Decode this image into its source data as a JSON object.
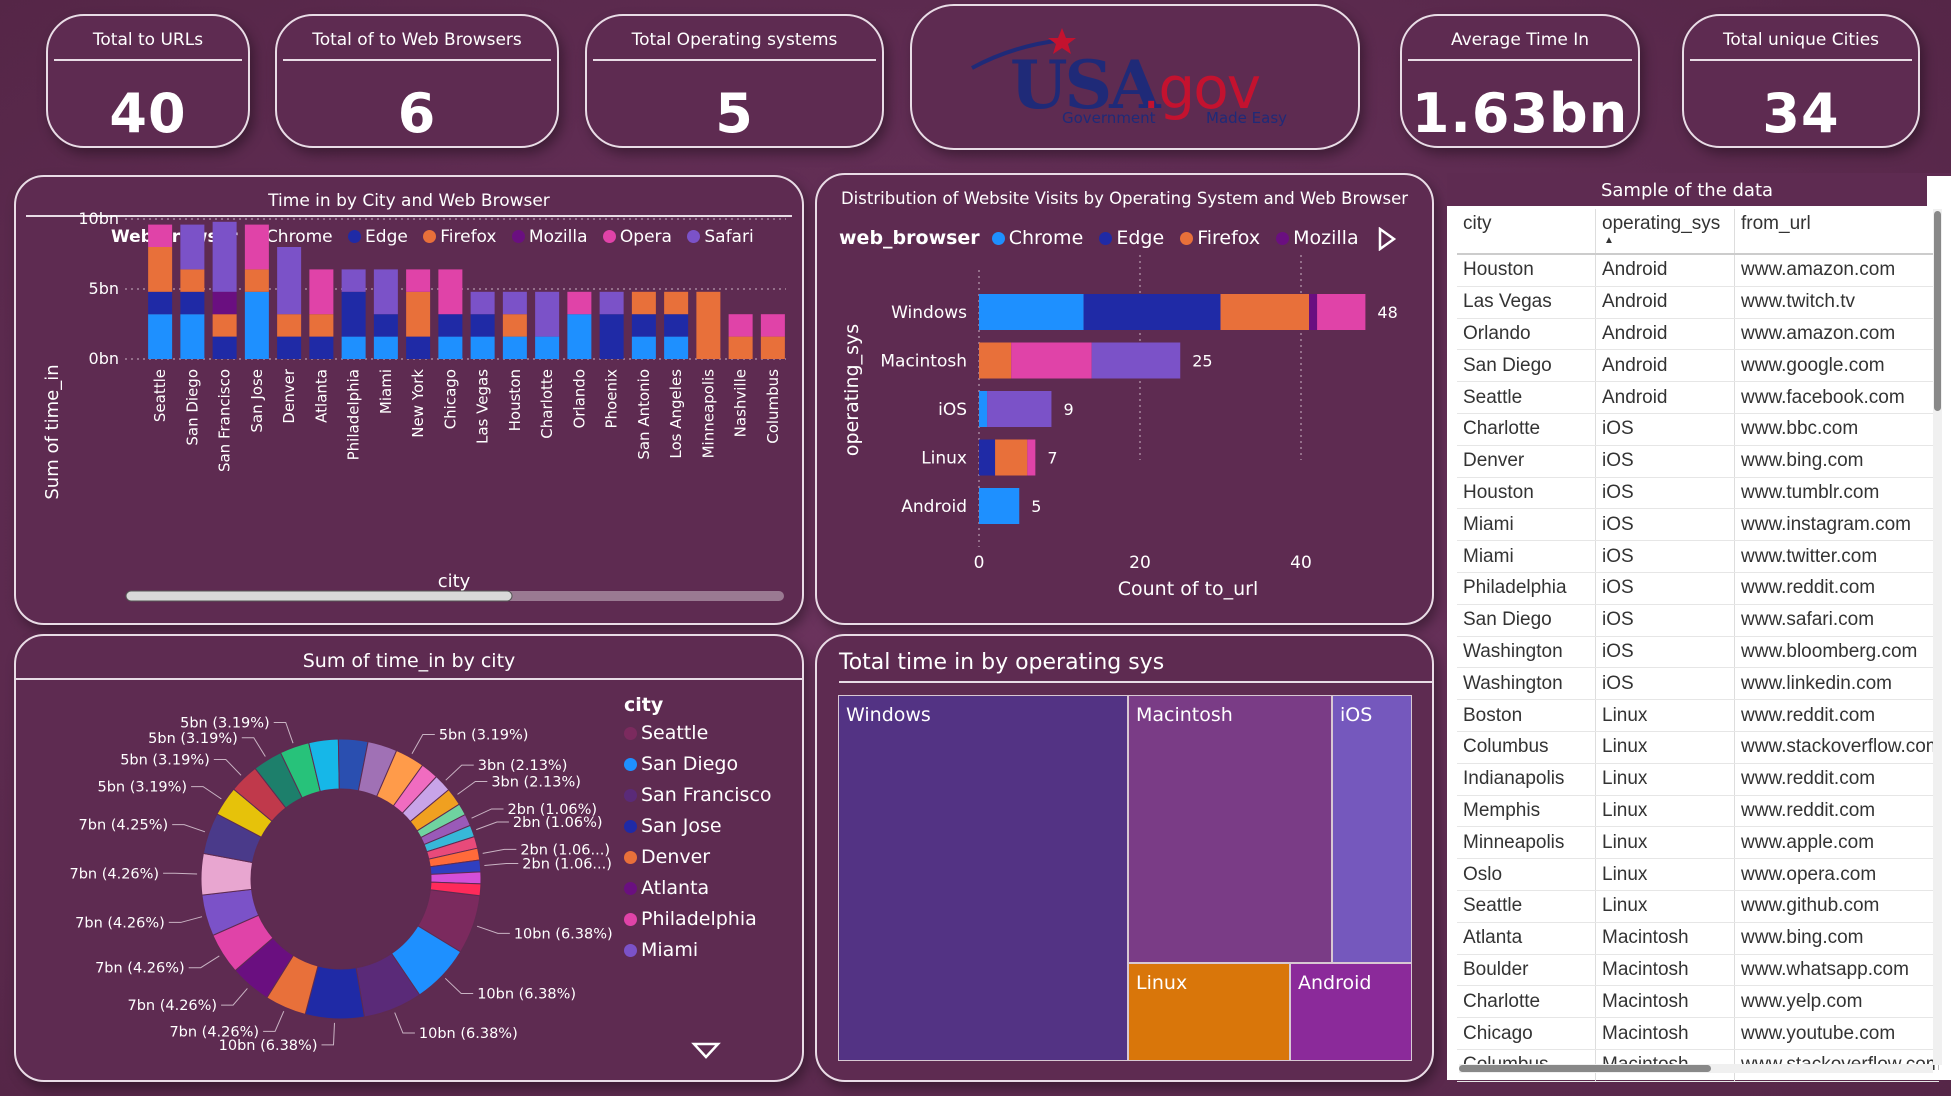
{
  "kpis": [
    {
      "title": "Total to URLs",
      "value": "40"
    },
    {
      "title": "Total of to Web Browsers",
      "value": "6"
    },
    {
      "title": "Total Operating systems",
      "value": "5"
    },
    {
      "title": "Average Time In",
      "value": "1.63bn"
    },
    {
      "title": "Total unique Cities",
      "value": "34"
    }
  ],
  "logo": {
    "main": "USA",
    "dot": ".gov",
    "left_tag": "Government",
    "right_tag": "Made Easy"
  },
  "colors": {
    "Chrome": "#1e90ff",
    "Edge": "#1f2aa6",
    "Firefox": "#e8703a",
    "Mozilla": "#6a0f80",
    "Opera": "#e043a8",
    "Safari": "#7b52c8"
  },
  "chart_data": [
    {
      "type": "bar",
      "title": "Time in by City and Web Browser",
      "legend_title": "Web Browser",
      "legend": [
        "Chrome",
        "Edge",
        "Firefox",
        "Mozilla",
        "Opera",
        "Safari"
      ],
      "xlabel": "city",
      "ylabel": "Sum of time_in",
      "yticks": [
        "0bn",
        "5bn",
        "10bn"
      ],
      "ylim": [
        0,
        10
      ],
      "categories": [
        "Seattle",
        "San Diego",
        "San Francisco",
        "San Jose",
        "Denver",
        "Atlanta",
        "Philadelphia",
        "Miami",
        "New York",
        "Chicago",
        "Las Vegas",
        "Houston",
        "Charlotte",
        "Orlando",
        "Phoenix",
        "San Antonio",
        "Los Angeles",
        "Minneapolis",
        "Nashville",
        "Columbus"
      ],
      "stacks": [
        [
          [
            "Chrome",
            3.2
          ],
          [
            "Edge",
            1.6
          ],
          [
            "Firefox",
            3.2
          ],
          [
            "Opera",
            1.6
          ]
        ],
        [
          [
            "Chrome",
            3.2
          ],
          [
            "Edge",
            1.6
          ],
          [
            "Firefox",
            1.6
          ],
          [
            "Safari",
            3.2
          ]
        ],
        [
          [
            "Edge",
            1.6
          ],
          [
            "Firefox",
            1.6
          ],
          [
            "Mozilla",
            1.6
          ],
          [
            "Safari",
            5.0
          ]
        ],
        [
          [
            "Chrome",
            4.8
          ],
          [
            "Firefox",
            1.6
          ],
          [
            "Opera",
            3.2
          ]
        ],
        [
          [
            "Edge",
            1.6
          ],
          [
            "Firefox",
            1.6
          ],
          [
            "Safari",
            4.8
          ]
        ],
        [
          [
            "Edge",
            1.6
          ],
          [
            "Firefox",
            1.6
          ],
          [
            "Opera",
            3.2
          ]
        ],
        [
          [
            "Chrome",
            1.6
          ],
          [
            "Edge",
            3.2
          ],
          [
            "Safari",
            1.6
          ]
        ],
        [
          [
            "Chrome",
            1.6
          ],
          [
            "Edge",
            1.6
          ],
          [
            "Safari",
            3.2
          ]
        ],
        [
          [
            "Edge",
            1.6
          ],
          [
            "Firefox",
            3.2
          ],
          [
            "Opera",
            1.6
          ]
        ],
        [
          [
            "Chrome",
            1.6
          ],
          [
            "Edge",
            1.6
          ],
          [
            "Opera",
            3.2
          ]
        ],
        [
          [
            "Chrome",
            1.6
          ],
          [
            "Edge",
            1.6
          ],
          [
            "Safari",
            1.6
          ]
        ],
        [
          [
            "Chrome",
            1.6
          ],
          [
            "Firefox",
            1.6
          ],
          [
            "Safari",
            1.6
          ]
        ],
        [
          [
            "Chrome",
            1.6
          ],
          [
            "Safari",
            3.2
          ]
        ],
        [
          [
            "Chrome",
            3.2
          ],
          [
            "Opera",
            1.6
          ]
        ],
        [
          [
            "Edge",
            3.2
          ],
          [
            "Safari",
            1.6
          ]
        ],
        [
          [
            "Chrome",
            1.6
          ],
          [
            "Edge",
            1.6
          ],
          [
            "Firefox",
            1.6
          ]
        ],
        [
          [
            "Chrome",
            1.6
          ],
          [
            "Edge",
            1.6
          ],
          [
            "Firefox",
            1.6
          ]
        ],
        [
          [
            "Firefox",
            4.8
          ]
        ],
        [
          [
            "Firefox",
            1.6
          ],
          [
            "Opera",
            1.6
          ]
        ],
        [
          [
            "Firefox",
            1.6
          ],
          [
            "Opera",
            1.6
          ]
        ]
      ]
    },
    {
      "type": "bar",
      "orientation": "horizontal",
      "title": "Distribution of Website Visits by Operating System and Web Browser",
      "legend_title": "web_browser",
      "legend": [
        "Chrome",
        "Edge",
        "Firefox",
        "Mozilla"
      ],
      "xlabel": "Count of to_url",
      "ylabel": "operating_sys",
      "xticks": [
        "0",
        "20",
        "40"
      ],
      "xlim": [
        0,
        50
      ],
      "categories": [
        "Windows",
        "Macintosh",
        "iOS",
        "Linux",
        "Android"
      ],
      "totals": [
        48,
        25,
        9,
        7,
        5
      ],
      "stacks": [
        [
          [
            "Chrome",
            13
          ],
          [
            "Edge",
            17
          ],
          [
            "Firefox",
            11
          ],
          [
            "Mozilla",
            1
          ],
          [
            "Opera",
            6
          ]
        ],
        [
          [
            "Firefox",
            4
          ],
          [
            "Opera",
            10
          ],
          [
            "Safari",
            11
          ]
        ],
        [
          [
            "Chrome",
            1
          ],
          [
            "Safari",
            8
          ]
        ],
        [
          [
            "Edge",
            2
          ],
          [
            "Firefox",
            4
          ],
          [
            "Opera",
            1
          ]
        ],
        [
          [
            "Chrome",
            5
          ]
        ]
      ]
    },
    {
      "type": "pie",
      "title": "Sum of time_in by city",
      "legend_title": "city",
      "legend": [
        "Seattle",
        "San Diego",
        "San Francisco",
        "San Jose",
        "Denver",
        "Atlanta",
        "Philadelphia",
        "Miami"
      ],
      "legend_colors": [
        "#7b2a5e",
        "#1e90ff",
        "#5a2a78",
        "#1f2aa6",
        "#e8703a",
        "#6a0f80",
        "#e043a8",
        "#7b52c8"
      ],
      "slices": [
        {
          "v": 10,
          "label": "10bn (6.38%)",
          "color": "#7b2a5e"
        },
        {
          "v": 10,
          "label": "10bn (6.38%)",
          "color": "#1e90ff"
        },
        {
          "v": 10,
          "label": "10bn (6.38%)",
          "color": "#5a2a78"
        },
        {
          "v": 10,
          "label": "10bn (6.38%)",
          "color": "#1f2aa6"
        },
        {
          "v": 7,
          "label": "7bn (4.26%)",
          "color": "#e8703a"
        },
        {
          "v": 7,
          "label": "7bn (4.26%)",
          "color": "#6a0f80"
        },
        {
          "v": 7,
          "label": "7bn (4.26%)",
          "color": "#e043a8"
        },
        {
          "v": 7,
          "label": "7bn (4.26%)",
          "color": "#7b52c8"
        },
        {
          "v": 7,
          "label": "7bn (4.26%)",
          "color": "#e8a6d0"
        },
        {
          "v": 7,
          "label": "7bn (4.25%)",
          "color": "#4a3a8a"
        },
        {
          "v": 5,
          "label": "5bn (3.19%)",
          "color": "#e6c20a"
        },
        {
          "v": 5,
          "label": "5bn (3.19%)",
          "color": "#c0394b"
        },
        {
          "v": 5,
          "label": "5bn (3.19%)",
          "color": "#1d7f6b"
        },
        {
          "v": 5,
          "label": "5bn (3.19%)",
          "color": "#27c27a"
        },
        {
          "v": 5,
          "label": "",
          "color": "#16b7e8"
        },
        {
          "v": 5,
          "label": "",
          "color": "#2a4fb0"
        },
        {
          "v": 5,
          "label": "",
          "color": "#a071b5"
        },
        {
          "v": 5,
          "label": "5bn (3.19%)",
          "color": "#ff9b4a"
        },
        {
          "v": 3,
          "label": "",
          "color": "#f06cc0"
        },
        {
          "v": 3,
          "label": "3bn (2.13%)",
          "color": "#c8a4e8"
        },
        {
          "v": 3,
          "label": "3bn (2.13%)",
          "color": "#f0a020"
        },
        {
          "v": 2,
          "label": "",
          "color": "#6fd3a0"
        },
        {
          "v": 2,
          "label": "2bn (1.06%)",
          "color": "#9a5ab8"
        },
        {
          "v": 2,
          "label": "2bn (1.06%)",
          "color": "#37b8d8"
        },
        {
          "v": 2,
          "label": "",
          "color": "#e84a7a"
        },
        {
          "v": 2,
          "label": "2bn (1.06...)",
          "color": "#ff6a3a"
        },
        {
          "v": 2,
          "label": "2bn (1.06...)",
          "color": "#2f3fc0"
        },
        {
          "v": 2,
          "label": "",
          "color": "#d44fd8"
        },
        {
          "v": 2,
          "label": "",
          "color": "#ff2a5a"
        }
      ]
    },
    {
      "type": "heatmap",
      "subtype": "treemap",
      "title": "Total time in by operating sys",
      "items": [
        {
          "name": "Windows",
          "color": "#533384"
        },
        {
          "name": "Macintosh",
          "color": "#7a3c86"
        },
        {
          "name": "iOS",
          "color": "#7558bd"
        },
        {
          "name": "Linux",
          "color": "#d9760a"
        },
        {
          "name": "Android",
          "color": "#8b2a9a"
        }
      ]
    }
  ],
  "table": {
    "title": "Sample of the data",
    "columns": [
      "city",
      "operating_sys",
      "from_url"
    ],
    "rows": [
      [
        "Houston",
        "Android",
        "www.amazon.com"
      ],
      [
        "Las Vegas",
        "Android",
        "www.twitch.tv"
      ],
      [
        "Orlando",
        "Android",
        "www.amazon.com"
      ],
      [
        "San Diego",
        "Android",
        "www.google.com"
      ],
      [
        "Seattle",
        "Android",
        "www.facebook.com"
      ],
      [
        "Charlotte",
        "iOS",
        "www.bbc.com"
      ],
      [
        "Denver",
        "iOS",
        "www.bing.com"
      ],
      [
        "Houston",
        "iOS",
        "www.tumblr.com"
      ],
      [
        "Miami",
        "iOS",
        "www.instagram.com"
      ],
      [
        "Miami",
        "iOS",
        "www.twitter.com"
      ],
      [
        "Philadelphia",
        "iOS",
        "www.reddit.com"
      ],
      [
        "San Diego",
        "iOS",
        "www.safari.com"
      ],
      [
        "Washington",
        "iOS",
        "www.bloomberg.com"
      ],
      [
        "Washington",
        "iOS",
        "www.linkedin.com"
      ],
      [
        "Boston",
        "Linux",
        "www.reddit.com"
      ],
      [
        "Columbus",
        "Linux",
        "www.stackoverflow.com"
      ],
      [
        "Indianapolis",
        "Linux",
        "www.reddit.com"
      ],
      [
        "Memphis",
        "Linux",
        "www.reddit.com"
      ],
      [
        "Minneapolis",
        "Linux",
        "www.apple.com"
      ],
      [
        "Oslo",
        "Linux",
        "www.opera.com"
      ],
      [
        "Seattle",
        "Linux",
        "www.github.com"
      ],
      [
        "Atlanta",
        "Macintosh",
        "www.bing.com"
      ],
      [
        "Boulder",
        "Macintosh",
        "www.whatsapp.com"
      ],
      [
        "Charlotte",
        "Macintosh",
        "www.yelp.com"
      ],
      [
        "Chicago",
        "Macintosh",
        "www.youtube.com"
      ],
      [
        "Columbus",
        "Macintosh",
        "www.stackoverflow.com"
      ]
    ]
  }
}
